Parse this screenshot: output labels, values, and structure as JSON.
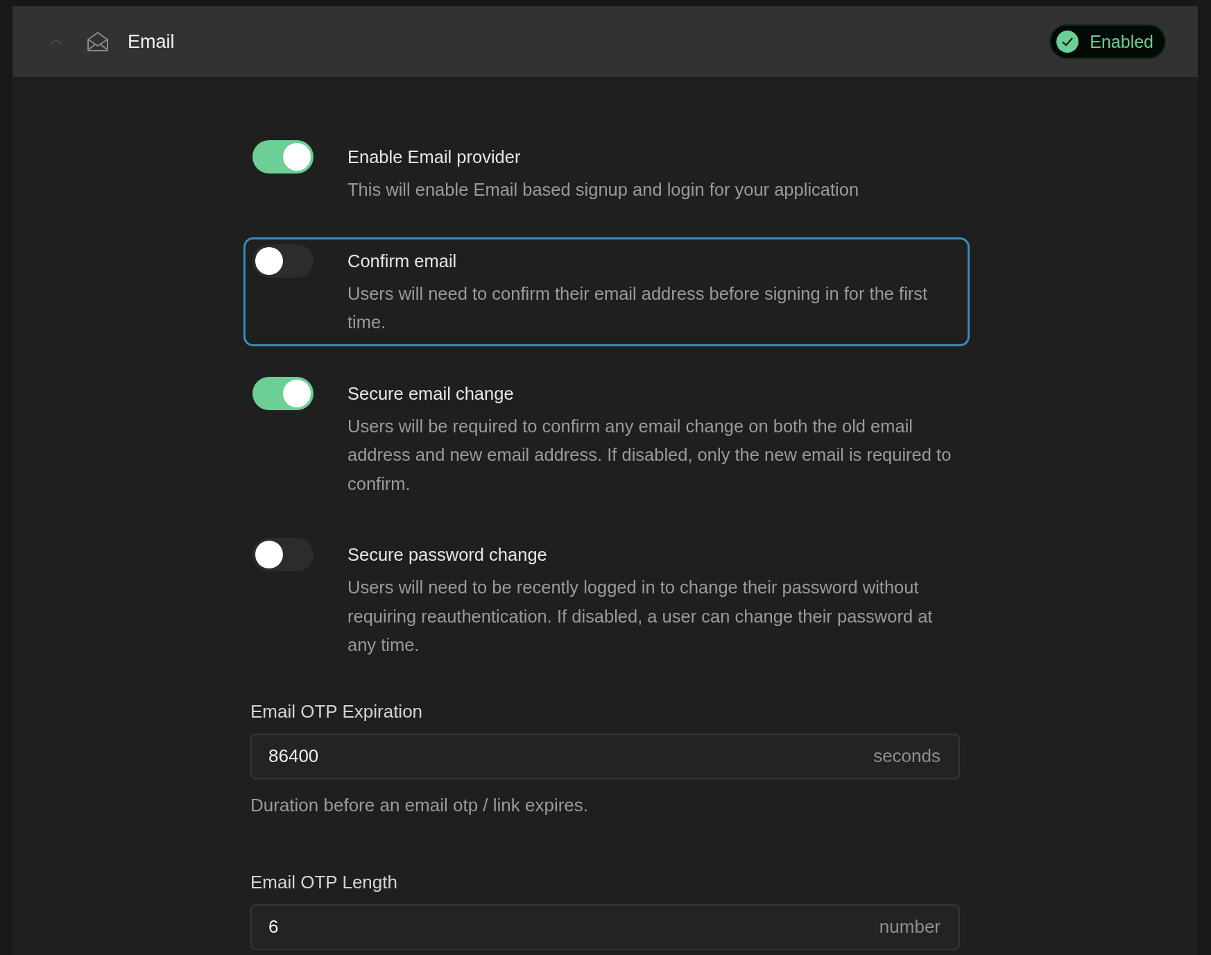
{
  "section": {
    "title": "Email",
    "expanded": true,
    "status": {
      "label": "Enabled",
      "enabled": true
    }
  },
  "settings": [
    {
      "kind": "toggle",
      "title": "Enable Email provider",
      "description": "This will enable Email based signup and login for your application",
      "on": true,
      "focused": false
    },
    {
      "kind": "toggle",
      "title": "Confirm email",
      "description": "Users will need to confirm their email address before signing in for the first time.",
      "on": false,
      "focused": true
    },
    {
      "kind": "toggle",
      "title": "Secure email change",
      "description": "Users will be required to confirm any email change on both the old email address and new email address. If disabled, only the new email is required to confirm.",
      "on": true,
      "focused": false
    },
    {
      "kind": "toggle",
      "title": "Secure password change",
      "description": "Users will need to be recently logged in to change their password without requiring reauthentication. If disabled, a user can change their password at any time.",
      "on": false,
      "focused": false
    },
    {
      "kind": "input",
      "label": "Email OTP Expiration",
      "value": "86400",
      "unit": "seconds",
      "help": "Duration before an email otp / link expires."
    },
    {
      "kind": "input",
      "label": "Email OTP Length",
      "value": "6",
      "unit": "number"
    }
  ]
}
